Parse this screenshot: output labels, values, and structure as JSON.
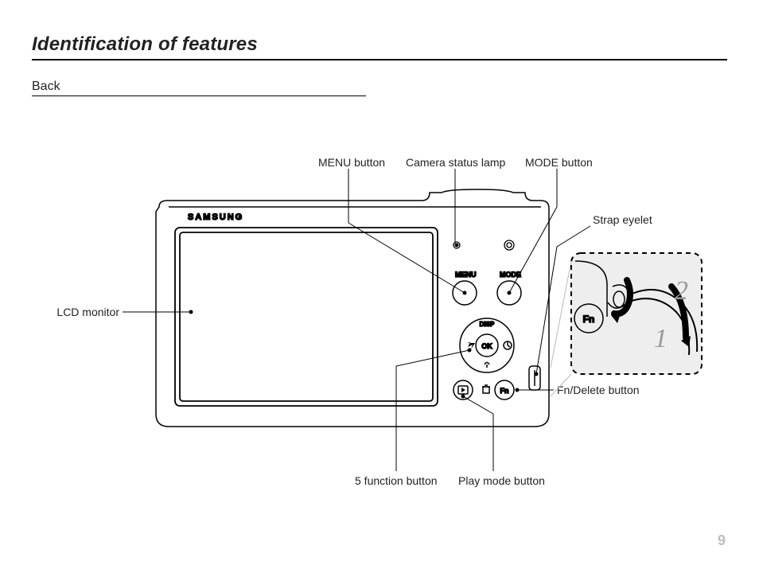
{
  "title": "Identification of features",
  "subtitle": "Back",
  "labels": {
    "menu_button": "MENU button",
    "camera_status_lamp": "Camera status lamp",
    "mode_button": "MODE button",
    "strap_eyelet": "Strap eyelet",
    "lcd_monitor": "LCD monitor",
    "fn_delete_button": "Fn/Delete button",
    "five_function_button": "5 function button",
    "play_mode_button": "Play mode button"
  },
  "camera_text": {
    "brand": "SAMSUNG",
    "menu": "MENU",
    "mode": "MODE",
    "disp": "DISP",
    "ok": "OK",
    "fn": "Fn"
  },
  "inset": {
    "fn": "Fn",
    "step1": "1",
    "step2": "2"
  },
  "page_number": "9"
}
